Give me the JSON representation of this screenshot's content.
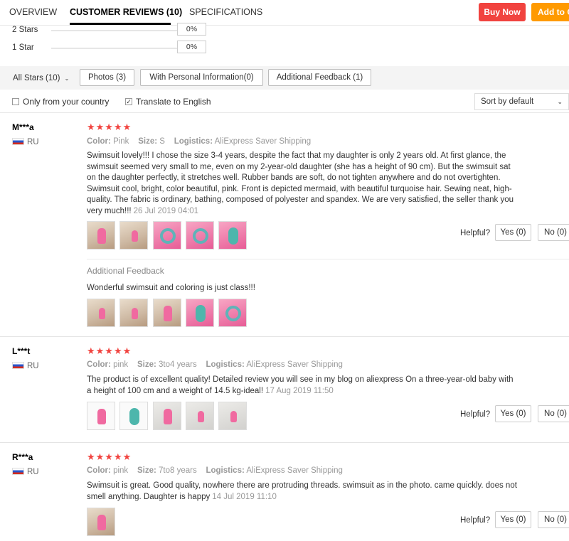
{
  "tabs": {
    "overview": "OVERVIEW",
    "reviews": "CUSTOMER REVIEWS (10)",
    "specs": "SPECIFICATIONS"
  },
  "actions": {
    "buy_now": "Buy Now",
    "add_to_cart": "Add to C"
  },
  "ratings": [
    {
      "label": "2 Stars",
      "pct": "0%"
    },
    {
      "label": "1 Star",
      "pct": "0%"
    }
  ],
  "filters": {
    "all_stars": "All Stars (10)",
    "photos": "Photos (3)",
    "personal": "With Personal Information(0)",
    "additional": "Additional Feedback (1)"
  },
  "options": {
    "own_country": "Only from your country",
    "translate": "Translate to English",
    "sort": "Sort by default"
  },
  "labels": {
    "color": "Color:",
    "size": "Size:",
    "logistics": "Logistics:",
    "helpful": "Helpful?",
    "additional_feedback": "Additional Feedback",
    "stars": "★★★★★"
  },
  "reviews": [
    {
      "user": "M***a",
      "country": "RU",
      "color": "Pink",
      "size": "S",
      "logistics": "AliExpress Saver Shipping",
      "text": "Swimsuit lovely!!! I chose the size 3-4 years, despite the fact that my daughter is only 2 years old. At first glance, the swimsuit seemed very small to me, even on my 2-year-old daughter (she has a height of 90 cm). But the swimsuit sat on the daughter perfectly, it stretches well. Rubber bands are soft, do not tighten anywhere and do not overtighten. Swimsuit cool, bright, color beautiful, pink. Front is depicted mermaid, with beautiful turquoise hair. Sewing neat, high-quality. The fabric is ordinary, bathing, composed of polyester and spandex. We are very satisfied, the seller thank you very much!!!",
      "date": "26 Jul 2019 04:01",
      "yes": "Yes (0)",
      "no": "No (0)",
      "additional_text": "Wonderful swimsuit and coloring is just class!!!"
    },
    {
      "user": "L***t",
      "country": "RU",
      "color": "pink",
      "size": "3to4 years",
      "logistics": "AliExpress Saver Shipping",
      "text": "The product is of excellent quality! Detailed review you will see in my blog on aliexpress On a three-year-old baby with a height of 100 cm and a weight of 14.5 kg-ideal!",
      "date": "17 Aug 2019 11:50",
      "yes": "Yes (0)",
      "no": "No (0)"
    },
    {
      "user": "R***a",
      "country": "RU",
      "color": "pink",
      "size": "7to8 years",
      "logistics": "AliExpress Saver Shipping",
      "text": "Swimsuit is great. Good quality, nowhere there are protruding threads. swimsuit as in the photo. came quickly. does not smell anything. Daughter is happy",
      "date": "14 Jul 2019 11:10",
      "yes": "Yes (0)",
      "no": "No (0)"
    }
  ],
  "colors": {
    "accent_red": "#f1433f",
    "accent_orange": "#ff9a00",
    "star": "#f1433f"
  }
}
